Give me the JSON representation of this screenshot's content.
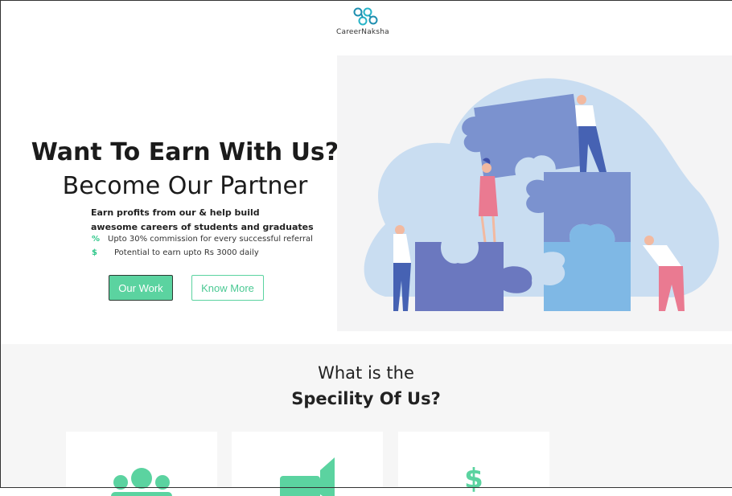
{
  "brand": {
    "name": "CareerNaksha"
  },
  "hero": {
    "title": "Want To Earn With Us?",
    "subtitle": "Become Our Partner",
    "tagline_line1": "Earn profits from our & help build",
    "tagline_line2": "awesome careers of students and graduates",
    "bullets": [
      {
        "icon": "percent-icon",
        "glyph": "%",
        "text": "Upto 30% commission for every successful referral"
      },
      {
        "icon": "dollar-icon",
        "glyph": "$",
        "text": "Potential to earn upto Rs 3000 daily"
      }
    ],
    "buttons": {
      "primary": "Our Work",
      "secondary": "Know More"
    }
  },
  "specialty": {
    "line1": "What is the",
    "line2": "Specility Of Us?",
    "cards": [
      {
        "icon": "users-group-icon"
      },
      {
        "icon": "megaphone-icon"
      },
      {
        "icon": "dollar-icon"
      }
    ]
  },
  "colors": {
    "accent": "#5bd3a0",
    "puzzle_dark": "#6b78bf",
    "puzzle_mid": "#7b92cf",
    "puzzle_light": "#7fb8e5",
    "blob": "#c9ddf1"
  }
}
